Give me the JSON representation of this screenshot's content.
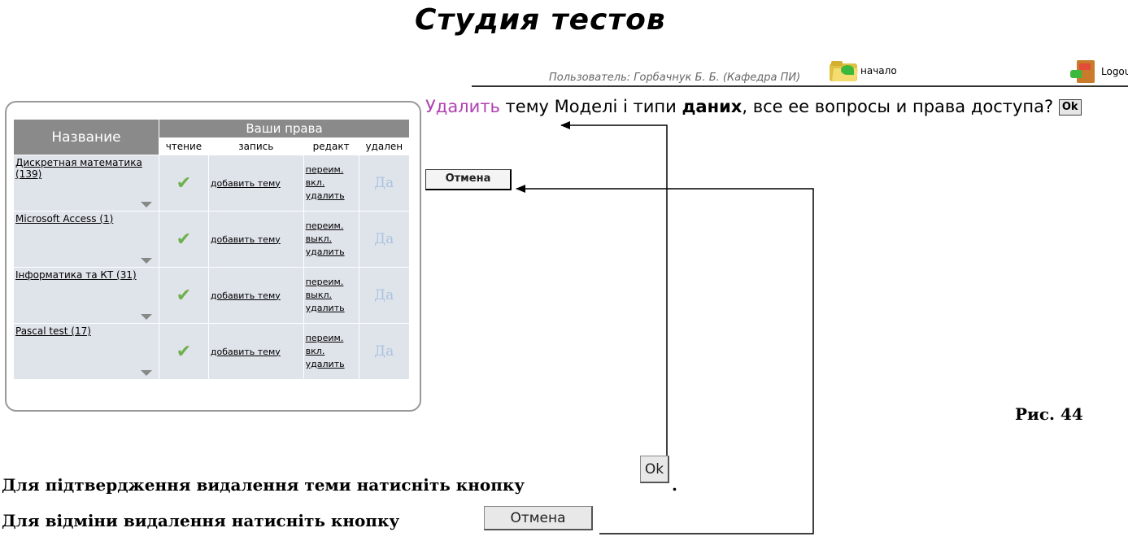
{
  "header": {
    "title": "Студия тестов",
    "user_line": "Пользователь: Горбачнук Б. Б. (Кафедра ПИ)",
    "home_label": "начало",
    "logout_label": "Logout"
  },
  "table": {
    "col_name": "Название",
    "col_rights": "Ваши права",
    "sub_headers": [
      "чтение",
      "запись",
      "редакт",
      "удален"
    ],
    "rows": [
      {
        "name": "Дискретная математика (139)",
        "write": "добавить тему",
        "edit": [
          "переим.",
          "вкл.",
          "удалить"
        ],
        "delete": "Да"
      },
      {
        "name": "Microsoft Access (1)",
        "write": "добавить тему",
        "edit": [
          "переим.",
          "выкл.",
          "удалить"
        ],
        "delete": "Да"
      },
      {
        "name": "Інформатика та КТ (31)",
        "write": "добавить тему",
        "edit": [
          "переим.",
          "выкл.",
          "удалить"
        ],
        "delete": "Да"
      },
      {
        "name": "Pascal test (17)",
        "write": "добавить тему",
        "edit": [
          "переим.",
          "вкл.",
          "удалить"
        ],
        "delete": "Да"
      }
    ]
  },
  "dialog": {
    "delete_link": "Удалить",
    "part1": " тему ",
    "topic": "Моделі і типи",
    "space": " ",
    "topic2": "даних",
    "part2": ", все ее вопросы и права доступа?",
    "ok_label": "Ok",
    "cancel_label": "Отмена"
  },
  "figure_label": "Рис. 44",
  "captions": {
    "confirm": "Для підтвердження видалення теми натисніть кнопку",
    "confirm_end": ".",
    "cancel": "Для відміни видалення натисніть кнопку",
    "ok_button": "Ok",
    "cancel_button": "Отмена"
  }
}
